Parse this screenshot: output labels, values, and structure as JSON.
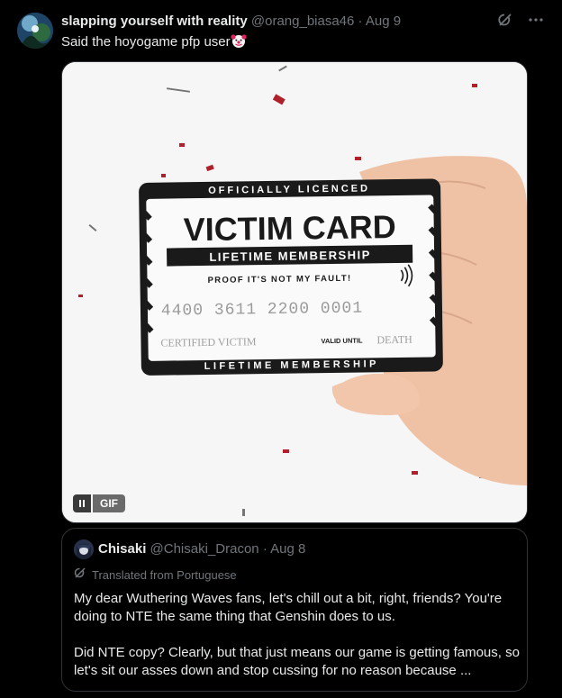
{
  "tweet": {
    "display_name": "slapping yourself with reality",
    "handle": "@orang_biasa46",
    "separator": "·",
    "date": "Aug 9",
    "text": "Said the hoyogame pfp user",
    "text_emoji": "clown-face",
    "icons": [
      "grok-icon",
      "more-icon"
    ]
  },
  "media": {
    "type": "gif",
    "gif_label": "GIF",
    "card": {
      "top_banner": "OFFICIALLY LICENCED",
      "title": "VICTIM CARD",
      "membership_box": "LIFETIME MEMBERSHIP",
      "tagline": "PROOF IT'S NOT MY FAULT!",
      "number": "4400 3611 2200 0001",
      "holder": "CERTIFIED VICTIM",
      "valid_label": "VALID UNTIL",
      "valid_value": "DEATH",
      "bottom_banner": "LIFETIME MEMBERSHIP"
    }
  },
  "quote": {
    "display_name": "Chisaki",
    "handle": "@Chisaki_Dracon",
    "separator": "·",
    "date": "Aug 8",
    "translated_label": "Translated from Portuguese",
    "paragraphs": [
      "My dear Wuthering Waves fans, let's chill out a bit, right, friends? You're doing to NTE the same thing that Genshin does to us.",
      "Did NTE copy? Clearly, but that just means our game is getting famous, so let's sit our asses down and stop cussing for no reason because ..."
    ]
  },
  "colors": {
    "background": "#000000",
    "text_primary": "#e7e9ea",
    "text_secondary": "#71767b",
    "border": "#2f3336"
  }
}
